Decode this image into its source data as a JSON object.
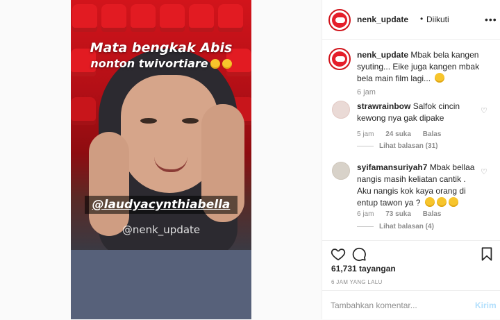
{
  "video": {
    "caption_line1": "Mata bengkak Abis",
    "caption_line2": "nonton twivortiare",
    "mention": "@laudyacynthiabella",
    "watermark": "@nenk_update"
  },
  "header": {
    "username": "nenk_update",
    "separator": "•",
    "follow_status": "Diikuti",
    "more_icon": "more-horizontal-icon"
  },
  "caption": {
    "username": "nenk_update",
    "text": "Mbak bela kangen syuting... Eike juga kangen mbak bela main film lagi...",
    "emoji": "smiling-face-icon",
    "time": "6 jam"
  },
  "comments": [
    {
      "username": "strawrainbow",
      "text": "Salfok cincin kewong nya gak dipake",
      "time": "5 jam",
      "likes": "24 suka",
      "reply": "Balas",
      "view_replies": "Lihat balasan (31)"
    },
    {
      "username": "syifamansuriyah7",
      "text": "Mbak bellaa nangis masih keliatan cantik . Aku nangis kok kaya orang di entup tawon ya ?",
      "time": "6 jam",
      "likes": "73 suka",
      "reply": "Balas",
      "view_replies": "Lihat balasan (4)"
    }
  ],
  "stats": {
    "views": "61,731 tayangan",
    "posted": "6 JAM YANG LALU"
  },
  "comment_box": {
    "placeholder": "Tambahkan komentar...",
    "post_label": "Kirim"
  },
  "colors": {
    "link_blue": "#b2dffc",
    "secondary_text": "#8e8e8e",
    "primary_text": "#262626"
  }
}
